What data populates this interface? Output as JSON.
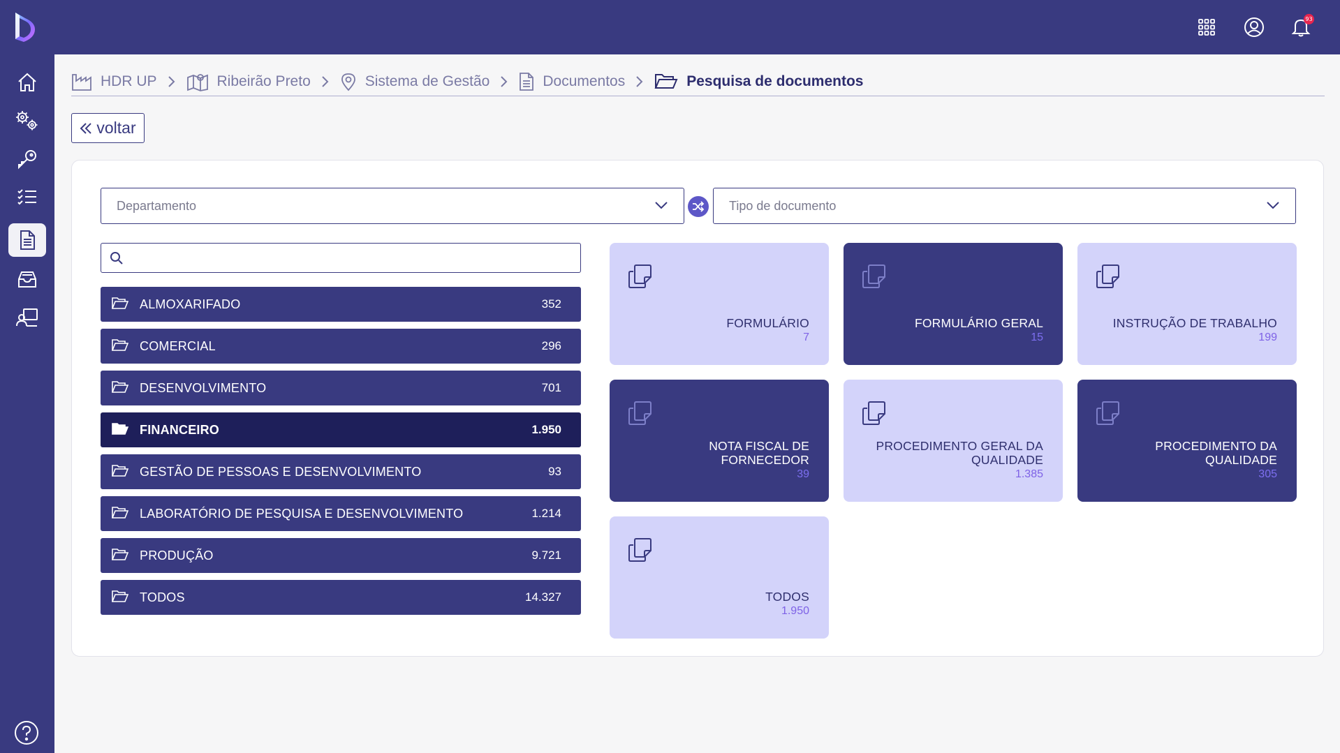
{
  "topbar": {
    "notifications_count": "93",
    "icons": [
      "logo-icon",
      "apps-grid-icon",
      "user-circle-icon",
      "bell-icon"
    ]
  },
  "sidebar": {
    "items": [
      {
        "icon": "home-icon",
        "active": false
      },
      {
        "icon": "settings-icon",
        "active": false
      },
      {
        "icon": "key-icon",
        "active": false
      },
      {
        "icon": "checklist-icon",
        "active": false
      },
      {
        "icon": "document-icon",
        "active": true
      },
      {
        "icon": "inbox-icon",
        "active": false
      },
      {
        "icon": "user-board-icon",
        "active": false
      }
    ],
    "help_icon": "help-icon"
  },
  "breadcrumb": [
    {
      "label": "HDR UP",
      "icon": "factory-icon"
    },
    {
      "label": "Ribeirão Preto",
      "icon": "map-icon"
    },
    {
      "label": "Sistema de Gestão",
      "icon": "location-pin-icon"
    },
    {
      "label": "Documentos",
      "icon": "document-icon"
    },
    {
      "label": "Pesquisa de documentos",
      "icon": "folder-open-icon"
    }
  ],
  "back_button": {
    "label": "voltar"
  },
  "filters": {
    "department_placeholder": "Departamento",
    "doc_type_placeholder": "Tipo de documento"
  },
  "search": {
    "value": "",
    "placeholder": ""
  },
  "departments": [
    {
      "name": "ALMOXARIFADO",
      "count": "352",
      "selected": false
    },
    {
      "name": "COMERCIAL",
      "count": "296",
      "selected": false
    },
    {
      "name": "DESENVOLVIMENTO",
      "count": "701",
      "selected": false
    },
    {
      "name": "FINANCEIRO",
      "count": "1.950",
      "selected": true
    },
    {
      "name": "GESTÃO DE PESSOAS E DESENVOLVIMENTO",
      "count": "93",
      "selected": false
    },
    {
      "name": "LABORATÓRIO DE PESQUISA E DESENVOLVIMENTO",
      "count": "1.214",
      "selected": false
    },
    {
      "name": "PRODUÇÃO",
      "count": "9.721",
      "selected": false
    },
    {
      "name": "TODOS",
      "count": "14.327",
      "selected": false
    }
  ],
  "doc_types": [
    {
      "title": "FORMULÁRIO",
      "count": "7",
      "style": "light"
    },
    {
      "title": "FORMULÁRIO GERAL",
      "count": "15",
      "style": "dark"
    },
    {
      "title": "INSTRUÇÃO DE TRABALHO",
      "count": "199",
      "style": "light"
    },
    {
      "title": "NOTA FISCAL DE FORNECEDOR",
      "count": "39",
      "style": "dark"
    },
    {
      "title": "PROCEDIMENTO GERAL DA QUALIDADE",
      "count": "1.385",
      "style": "light"
    },
    {
      "title": "PROCEDIMENTO DA QUALIDADE",
      "count": "305",
      "style": "dark"
    },
    {
      "title": "TODOS",
      "count": "1.950",
      "style": "light"
    }
  ],
  "colors": {
    "primary": "#393a80",
    "primary_dark": "#1e1f5a",
    "card_light": "#d3d3fa",
    "accent": "#5d57c7",
    "badge": "#e8244e"
  }
}
